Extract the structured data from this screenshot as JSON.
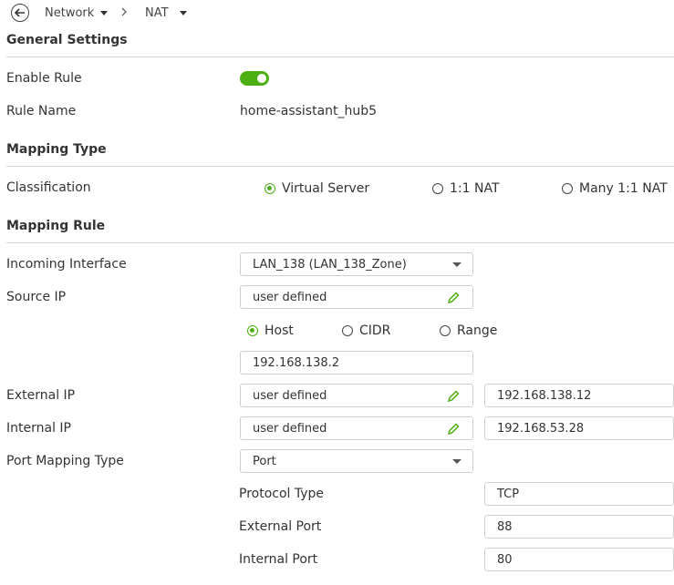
{
  "breadcrumb": {
    "items": [
      "Network",
      "NAT"
    ]
  },
  "sections": {
    "general": "General Settings",
    "mapping_type": "Mapping Type",
    "mapping_rule": "Mapping Rule"
  },
  "general": {
    "enable_rule_label": "Enable Rule",
    "enable_rule_on": true,
    "rule_name_label": "Rule Name",
    "rule_name_value": "home-assistant_hub5"
  },
  "mapping_type": {
    "classification_label": "Classification",
    "options": [
      "Virtual Server",
      "1:1 NAT",
      "Many 1:1 NAT"
    ],
    "selected": "Virtual Server"
  },
  "mapping_rule": {
    "incoming_interface_label": "Incoming Interface",
    "incoming_interface_value": "LAN_138 (LAN_138_Zone)",
    "source_ip_label": "Source IP",
    "source_ip_value": "user defined",
    "source_ip_options": [
      "Host",
      "CIDR",
      "Range"
    ],
    "source_ip_selected": "Host",
    "source_ip_host": "192.168.138.2",
    "external_ip_label": "External IP",
    "external_ip_mode": "user defined",
    "external_ip_value": "192.168.138.12",
    "internal_ip_label": "Internal IP",
    "internal_ip_mode": "user defined",
    "internal_ip_value": "192.168.53.28",
    "port_mapping_type_label": "Port Mapping Type",
    "port_mapping_type_value": "Port",
    "protocol_type_label": "Protocol Type",
    "protocol_type_value": "TCP",
    "external_port_label": "External Port",
    "external_port_value": "88",
    "internal_port_label": "Internal Port",
    "internal_port_value": "80"
  },
  "colors": {
    "accent": "#4caf13",
    "divider": "#d6d6d6",
    "border": "#cfcfcf"
  }
}
